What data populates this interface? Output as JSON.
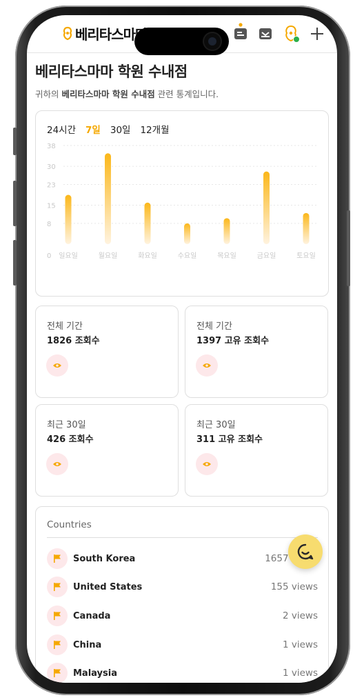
{
  "header": {
    "logo_text": "베리타스마마",
    "icons": [
      "profile-card-icon",
      "inbox-icon",
      "location-pin-icon",
      "plus-icon"
    ]
  },
  "page": {
    "title": "베리타스마마 학원 수내점",
    "subtitle_prefix": "귀하의 ",
    "subtitle_bold": "베리타스마마 학원 수내점",
    "subtitle_suffix": " 관련 통계입니다."
  },
  "tabs": [
    {
      "label": "24시간",
      "active": false
    },
    {
      "label": "7일",
      "active": true
    },
    {
      "label": "30일",
      "active": false
    },
    {
      "label": "12개월",
      "active": false
    }
  ],
  "chart_data": {
    "type": "bar",
    "categories": [
      "일요일",
      "월요일",
      "화요일",
      "수요일",
      "목요일",
      "금요일",
      "토요일"
    ],
    "values": [
      19,
      35,
      16,
      8,
      10,
      28,
      12
    ],
    "yticks": [
      0,
      8,
      15,
      23,
      30,
      38
    ],
    "ylim": [
      0,
      38
    ],
    "title": "",
    "xlabel": "",
    "ylabel": "",
    "colors": {
      "bar_top": "#fbb71a",
      "bar_bottom": "#fff3df",
      "grid": "#e6e6e6",
      "tick": "#c8c8c8"
    }
  },
  "stats": [
    {
      "label": "전체 기간",
      "value": "1826 조회수"
    },
    {
      "label": "전체 기간",
      "value": "1397 고유 조회수"
    },
    {
      "label": "최근 30일",
      "value": "426 조회수"
    },
    {
      "label": "최근 30일",
      "value": "311 고유 조회수"
    }
  ],
  "countries": {
    "heading": "Countries",
    "rows": [
      {
        "name": "South Korea",
        "views": "1657 views"
      },
      {
        "name": "United States",
        "views": "155 views"
      },
      {
        "name": "Canada",
        "views": "2 views"
      },
      {
        "name": "China",
        "views": "1 views"
      },
      {
        "name": "Malaysia",
        "views": "1 views"
      }
    ]
  },
  "colors": {
    "accent": "#f5a800",
    "pink_bg": "#fde8ea",
    "fab": "#f7dc6f",
    "online": "#2bb04a"
  }
}
